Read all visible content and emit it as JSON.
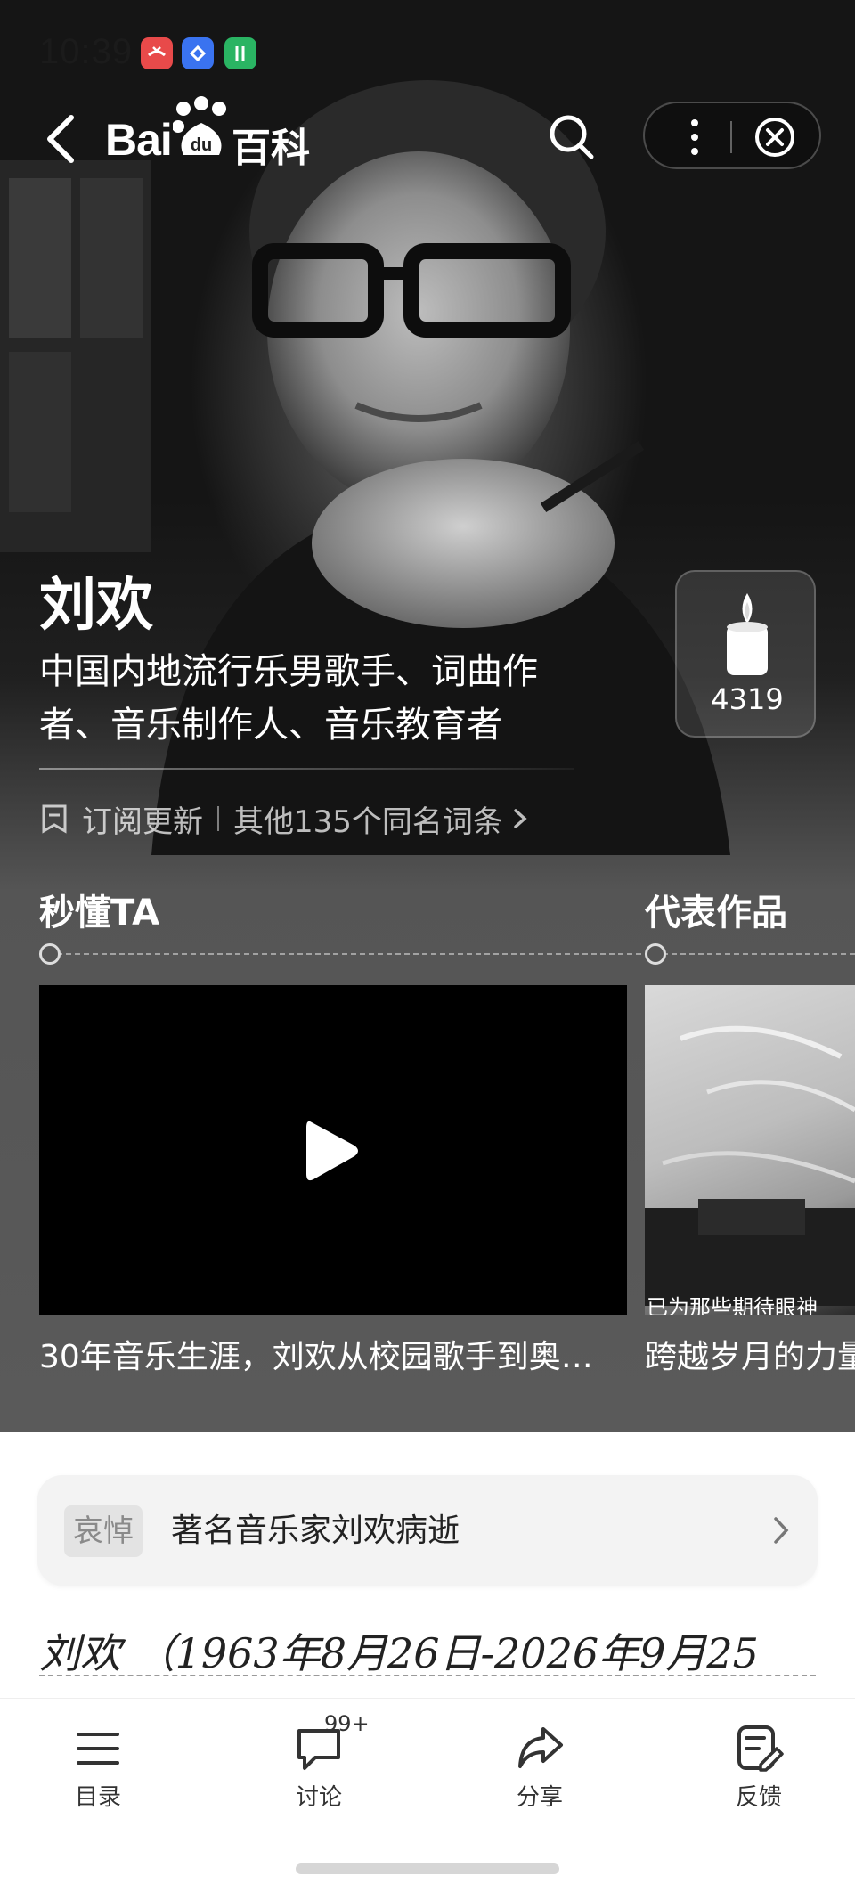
{
  "status_bar": {
    "time": "10:39",
    "apps": [
      {
        "icon": "phone-missed-icon",
        "color": "#e84a4a"
      },
      {
        "icon": "sync-icon",
        "color": "#3a73f0"
      },
      {
        "icon": "data-transfer-icon",
        "color": "#2ab463"
      }
    ]
  },
  "nav": {
    "logo_bai": "Bai",
    "logo_du": "du",
    "logo_baike": "百科"
  },
  "hero": {
    "name": "刘欢",
    "description": "中国内地流行乐男歌手、词曲作者、音乐制作人、音乐教育者",
    "subscribe_label": "订阅更新",
    "other_entries_label": "其他135个同名词条",
    "candle_count": "4319"
  },
  "sections": {
    "quick_title": "秒懂TA",
    "works_title": "代表作品",
    "video_caption": "30年音乐生涯，刘欢从校园歌手到奥…",
    "work_caption": "跨越岁月的力量",
    "work_image_text": "已为那些期待眼神"
  },
  "notice": {
    "tag": "哀悼",
    "text": "著名音乐家刘欢病逝"
  },
  "article": {
    "heading": "刘欢 （1963年8月26日-2026年9月25"
  },
  "tabbar": {
    "items": [
      {
        "label": "目录",
        "icon": "list-icon"
      },
      {
        "label": "讨论",
        "icon": "comment-icon"
      },
      {
        "label": "分享",
        "icon": "share-icon"
      },
      {
        "label": "反馈",
        "icon": "feedback-icon"
      }
    ],
    "discussion_badge": "99+"
  },
  "colors": {
    "hero_bottom": "#5a5a5a",
    "text_white": "#ffffff",
    "card_bg": "#f3f3f3"
  }
}
